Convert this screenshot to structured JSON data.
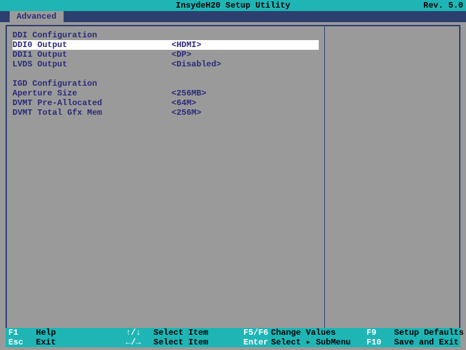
{
  "title": "InsydeH20 Setup Utility",
  "revision": "Rev. 5.0",
  "tab": "Advanced",
  "sections": {
    "ddi": {
      "heading": "DDI Configuration",
      "ddi0": {
        "label": "DDI0 Output",
        "value": "<HDMI>"
      },
      "ddi1": {
        "label": "DDI1 Output",
        "value": "<DP>"
      },
      "lvds": {
        "label": "LVDS Output",
        "value": "<Disabled>"
      }
    },
    "igd": {
      "heading": "IGD Configuration",
      "aperture": {
        "label": "Aperture Size",
        "value": "<256MB>"
      },
      "dvmt_pre": {
        "label": "DVMT Pre-Allocated",
        "value": "<64M>"
      },
      "dvmt_total": {
        "label": "DVMT Total Gfx Mem",
        "value": "<256M>"
      }
    }
  },
  "footer": {
    "f1": {
      "key": "F1",
      "txt": "Help"
    },
    "esc": {
      "key": "Esc",
      "txt": "Exit"
    },
    "updown": {
      "key": "↑/↓",
      "txt": "Select Item"
    },
    "leftright": {
      "key": "←/→",
      "txt": "Select Item"
    },
    "f5f6": {
      "key": "F5/F6",
      "txt": "Change Values"
    },
    "enter": {
      "key": "Enter",
      "txt": "Select ▸ SubMenu"
    },
    "f9": {
      "key": "F9",
      "txt": "Setup Defaults"
    },
    "f10": {
      "key": "F10",
      "txt": "Save and Exit"
    }
  }
}
